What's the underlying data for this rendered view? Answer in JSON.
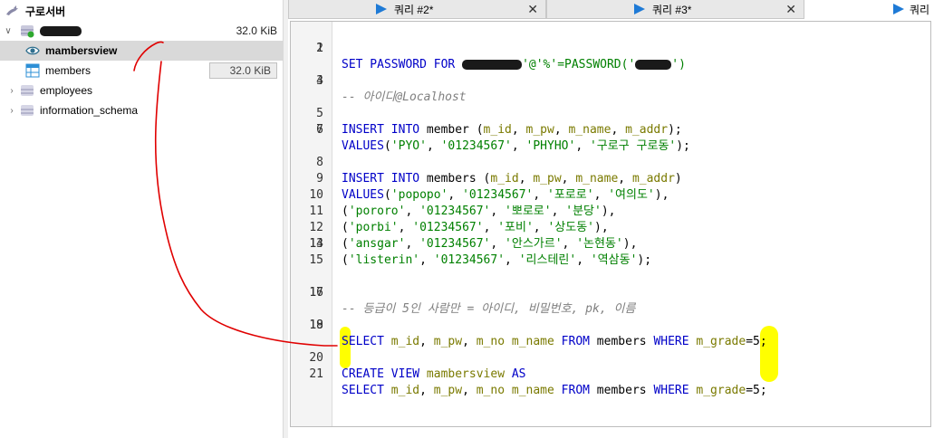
{
  "tree": {
    "server": {
      "label": "구로서버"
    },
    "database": {
      "size": "32.0 KiB"
    },
    "items": [
      {
        "label": "mambersview"
      },
      {
        "label": "members",
        "size": "32.0 KiB"
      },
      {
        "label": "employees"
      },
      {
        "label": "information_schema"
      }
    ]
  },
  "tabs": [
    {
      "label": "쿼리 #2*"
    },
    {
      "label": "쿼리 #3*"
    },
    {
      "label": "쿼리"
    }
  ],
  "editor": {
    "line_numbers": [
      "1",
      "2",
      "3",
      "4",
      "5",
      "6",
      "7",
      "8",
      "9",
      "10",
      "11",
      "12",
      "13",
      "14",
      "15",
      "16",
      "17",
      "18",
      "19",
      "20",
      "21"
    ],
    "lines": {
      "l1": [
        "SET PASSWORD FOR ",
        "'@'%'=PASSWORD('",
        "')"
      ],
      "l3": "-- 아이디@Localhost",
      "l5": [
        "INSERT INTO",
        " member (",
        "m_id",
        ", ",
        "m_pw",
        ", ",
        "m_name",
        ", ",
        "m_addr",
        ");"
      ],
      "l6": [
        "VALUES",
        "(",
        "'PYO'",
        ", ",
        "'01234567'",
        ", ",
        "'PHYHO'",
        ", ",
        "'구로구 구로동'",
        ");"
      ],
      "l8": [
        "INSERT INTO",
        " members (",
        "m_id",
        ", ",
        "m_pw",
        ", ",
        "m_name",
        ", ",
        "m_addr",
        ")"
      ],
      "l9": [
        "VALUES",
        "(",
        "'popopo'",
        ", ",
        "'01234567'",
        ", ",
        "'포로로'",
        ", ",
        "'여의도'",
        "),"
      ],
      "l10": [
        "(",
        "'pororo'",
        ", ",
        "'01234567'",
        ", ",
        "'뽀로로'",
        ", ",
        "'분당'",
        "),"
      ],
      "l11": [
        "(",
        "'porbi'",
        ", ",
        "'01234567'",
        ", ",
        "'포비'",
        ", ",
        "'상도동'",
        "),"
      ],
      "l12": [
        "(",
        "'ansgar'",
        ", ",
        "'01234567'",
        ", ",
        "'안스가르'",
        ", ",
        "'논현동'",
        "),"
      ],
      "l13": [
        "(",
        "'listerin'",
        ", ",
        "'01234567'",
        ", ",
        "'리스테린'",
        ", ",
        "'역삼동'",
        ");"
      ],
      "l16": "-- 등급이 5인 사람만 = 아이디, 비밀번호, pk, 이름",
      "l18": [
        "SELECT",
        " ",
        "m_id",
        ", ",
        "m_pw",
        ", ",
        "m_no",
        " ",
        "m_name",
        " ",
        "FROM",
        " members ",
        "WHERE",
        " ",
        "m_grade",
        "=5;"
      ],
      "l20": [
        "CREATE VIEW",
        " ",
        "mambersview",
        " ",
        "AS"
      ],
      "l21": [
        "SELECT",
        " ",
        "m_id",
        ", ",
        "m_pw",
        ", ",
        "m_no",
        " ",
        "m_name",
        " ",
        "FROM",
        " members ",
        "WHERE",
        " ",
        "m_grade",
        "=5;"
      ]
    }
  },
  "colors": {
    "keyword": "#0000c8",
    "identifier": "#7a7a00",
    "string": "#008000",
    "comment": "#808080",
    "annotation_red": "#e00000",
    "highlight_yellow": "#ffff00",
    "play_icon": "#1e7ad6"
  },
  "icons": [
    "dolphin-server-icon",
    "database-icon",
    "view-eye-icon",
    "table-icon",
    "play-icon",
    "close-icon"
  ]
}
